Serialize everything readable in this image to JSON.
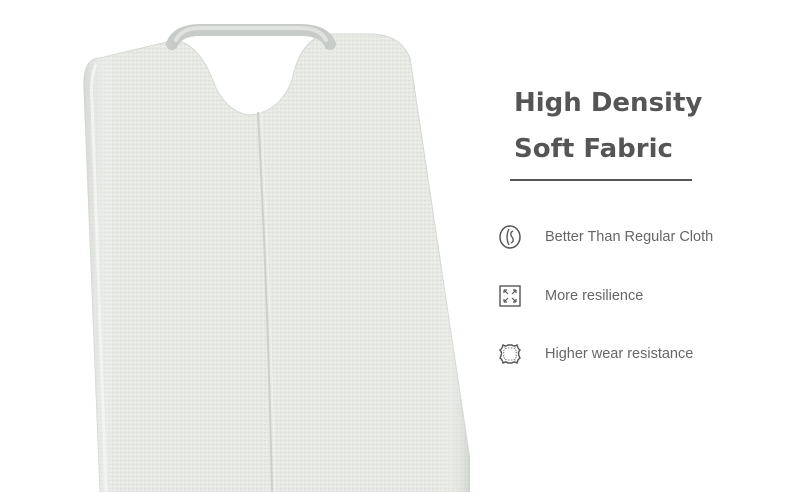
{
  "title": {
    "line1": "High Density",
    "line2": "Soft Fabric"
  },
  "features": [
    {
      "icon": "coin-icon",
      "label": "Better Than Regular Cloth"
    },
    {
      "icon": "expand-arrows-icon",
      "label": "More resilience"
    },
    {
      "icon": "leather-hide-icon",
      "label": "Higher wear resistance"
    }
  ],
  "colors": {
    "text": "#555555",
    "fabric": "#e6e9e4",
    "handle": "#c8ccc8"
  }
}
